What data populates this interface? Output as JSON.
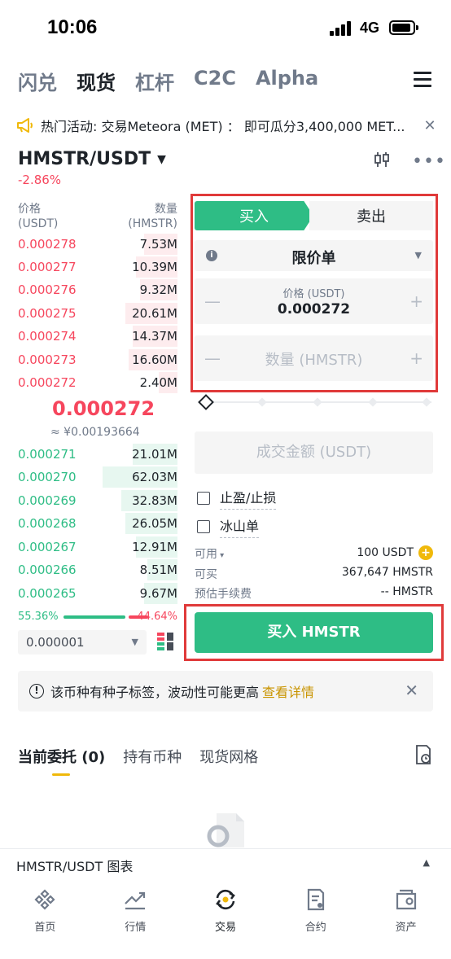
{
  "status_bar": {
    "time": "10:06",
    "network": "4G"
  },
  "top_tabs": [
    {
      "label": "闪兑",
      "active": false
    },
    {
      "label": "现货",
      "active": true
    },
    {
      "label": "杠杆",
      "active": false
    },
    {
      "label": "C2C",
      "active": false
    },
    {
      "label": "Alpha",
      "active": false
    }
  ],
  "announcement": {
    "text": "热门活动: 交易Meteora (MET) ： 即可瓜分3,400,000 MET..."
  },
  "pair": {
    "symbol": "HMSTR/USDT",
    "change": "-2.86%"
  },
  "order_book": {
    "price_header": "价格",
    "price_unit": "(USDT)",
    "qty_header": "数量",
    "qty_unit": "(HMSTR)",
    "asks": [
      {
        "price": "0.000278",
        "qty": "7.53M",
        "depth": 0.45
      },
      {
        "price": "0.000277",
        "qty": "10.39M",
        "depth": 0.55
      },
      {
        "price": "0.000276",
        "qty": "9.32M",
        "depth": 0.5
      },
      {
        "price": "0.000275",
        "qty": "20.61M",
        "depth": 0.7
      },
      {
        "price": "0.000274",
        "qty": "14.37M",
        "depth": 0.6
      },
      {
        "price": "0.000273",
        "qty": "16.60M",
        "depth": 0.65
      },
      {
        "price": "0.000272",
        "qty": "2.40M",
        "depth": 0.25
      }
    ],
    "last_price": "0.000272",
    "last_price_cny": "≈ ¥0.00193664",
    "bids": [
      {
        "price": "0.000271",
        "qty": "21.01M",
        "depth": 0.6
      },
      {
        "price": "0.000270",
        "qty": "62.03M",
        "depth": 1.0
      },
      {
        "price": "0.000269",
        "qty": "32.83M",
        "depth": 0.75
      },
      {
        "price": "0.000268",
        "qty": "26.05M",
        "depth": 0.7
      },
      {
        "price": "0.000267",
        "qty": "12.91M",
        "depth": 0.55
      },
      {
        "price": "0.000266",
        "qty": "8.51M",
        "depth": 0.4
      },
      {
        "price": "0.000265",
        "qty": "9.67M",
        "depth": 0.45
      }
    ],
    "buy_ratio": "55.36%",
    "sell_ratio": "44.64%",
    "precision": "0.000001"
  },
  "order_form": {
    "buy_label": "买入",
    "sell_label": "卖出",
    "order_type": "限价单",
    "price_label": "价格 (USDT)",
    "price_value": "0.000272",
    "qty_placeholder": "数量 (HMSTR)",
    "total_placeholder": "成交金额 (USDT)",
    "tpsl_label": "止盈/止损",
    "iceberg_label": "冰山单",
    "available_label": "可用",
    "available_value": "100 USDT",
    "can_buy_label": "可买",
    "can_buy_value": "367,647 HMSTR",
    "fee_label": "预估手续费",
    "fee_value": "-- HMSTR",
    "submit_label": "买入 HMSTR"
  },
  "warning": {
    "message": "该币种有种子标签，波动性可能更高",
    "link": "查看详情"
  },
  "orders_tabs": [
    {
      "label": "当前委托 (0)",
      "active": true
    },
    {
      "label": "持有币种",
      "active": false
    },
    {
      "label": "现货网格",
      "active": false
    }
  ],
  "chart_drawer": {
    "title": "HMSTR/USDT 图表"
  },
  "bottom_nav": [
    {
      "label": "首页",
      "icon": "home-icon"
    },
    {
      "label": "行情",
      "icon": "markets-icon"
    },
    {
      "label": "交易",
      "icon": "trade-icon"
    },
    {
      "label": "合约",
      "icon": "futures-icon"
    },
    {
      "label": "资产",
      "icon": "wallet-icon"
    }
  ],
  "colors": {
    "buy": "#2ebd85",
    "sell": "#f6465d",
    "accent": "#f0b90b",
    "highlight": "#e03a3a"
  }
}
